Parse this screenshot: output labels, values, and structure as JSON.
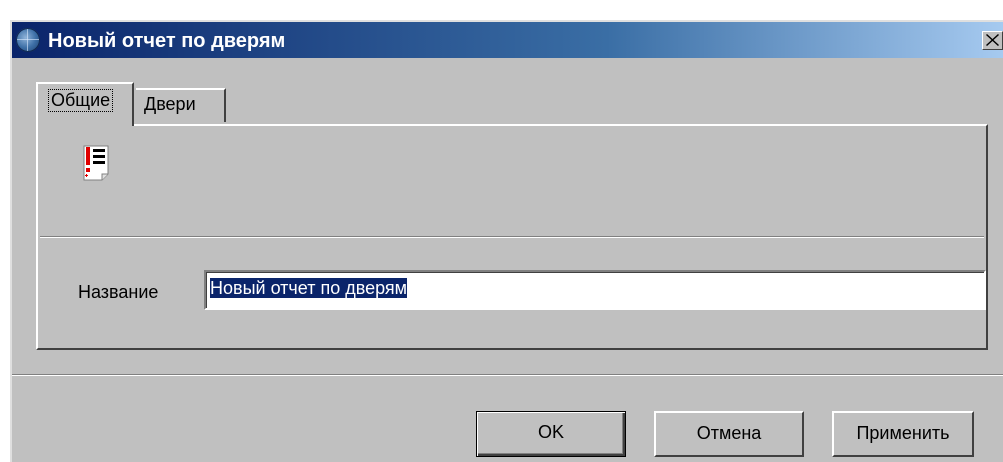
{
  "window": {
    "title": "Новый отчет по дверям",
    "close_label": "✕",
    "icon": "globe-icon"
  },
  "tabs": [
    {
      "label": "Общие",
      "active": true
    },
    {
      "label": "Двери",
      "active": false
    }
  ],
  "general": {
    "report_icon": "report-list-icon",
    "name_label": "Название",
    "name_value": "Новый отчет по дверям"
  },
  "buttons": {
    "ok": "OK",
    "cancel": "Отмена",
    "apply": "Применить"
  },
  "colors": {
    "title_start": "#0a246a",
    "title_end": "#a6caf0",
    "face": "#c0c0c0",
    "selection": "#0a246a"
  }
}
